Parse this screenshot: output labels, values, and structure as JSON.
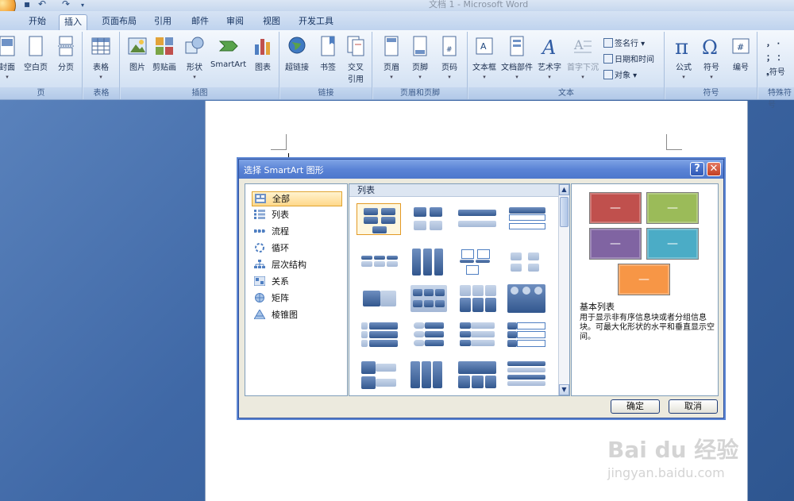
{
  "window": {
    "title": "文档 1 - Microsoft Word"
  },
  "tabs": [
    "开始",
    "插入",
    "页面布局",
    "引用",
    "邮件",
    "审阅",
    "视图",
    "开发工具"
  ],
  "active_tab": "插入",
  "ribbon": {
    "groups": {
      "page": "页",
      "table": "表格",
      "illustrations": "插图",
      "links": "链接",
      "header_footer": "页眉和页脚",
      "text": "文本",
      "symbols": "符号",
      "special": "特殊符号"
    },
    "buttons": {
      "cover": "封面",
      "blank_page": "空白页",
      "page_break": "分页",
      "table": "表格",
      "picture": "图片",
      "clip_art": "剪贴画",
      "shapes": "形状",
      "smartart": "SmartArt",
      "chart": "图表",
      "hyperlink": "超链接",
      "bookmark": "书签",
      "cross_ref_1": "交叉",
      "cross_ref_2": "引用",
      "header": "页眉",
      "footer": "页脚",
      "page_number": "页码",
      "text_box": "文本框",
      "quick_parts": "文档部件",
      "wordart": "艺术字",
      "drop_cap": "首字下沉",
      "signature_line": "签名行",
      "date_time": "日期和时间",
      "object": "对象",
      "equation": "公式",
      "symbol": "符号",
      "number": "编号",
      "special_symbol": "符号"
    }
  },
  "dialog": {
    "title": "选择 SmartArt 图形",
    "help": "?",
    "close": "✕",
    "categories": [
      "全部",
      "列表",
      "流程",
      "循环",
      "层次结构",
      "关系",
      "矩阵",
      "棱锥图"
    ],
    "selected_category": "全部",
    "gallery_header": "列表",
    "preview": {
      "name": "基本列表",
      "description": "用于显示非有序信息块或者分组信息块。可最大化形状的水平和垂直显示空间。",
      "box_text": "—",
      "colors": [
        "#c0504d",
        "#9bbb59",
        "#8064a2",
        "#4bacc6",
        "#f79646"
      ]
    },
    "ok": "确定",
    "cancel": "取消"
  },
  "watermark": {
    "line1": "Bai du 经验",
    "line2": "jingyan.baidu.com"
  }
}
